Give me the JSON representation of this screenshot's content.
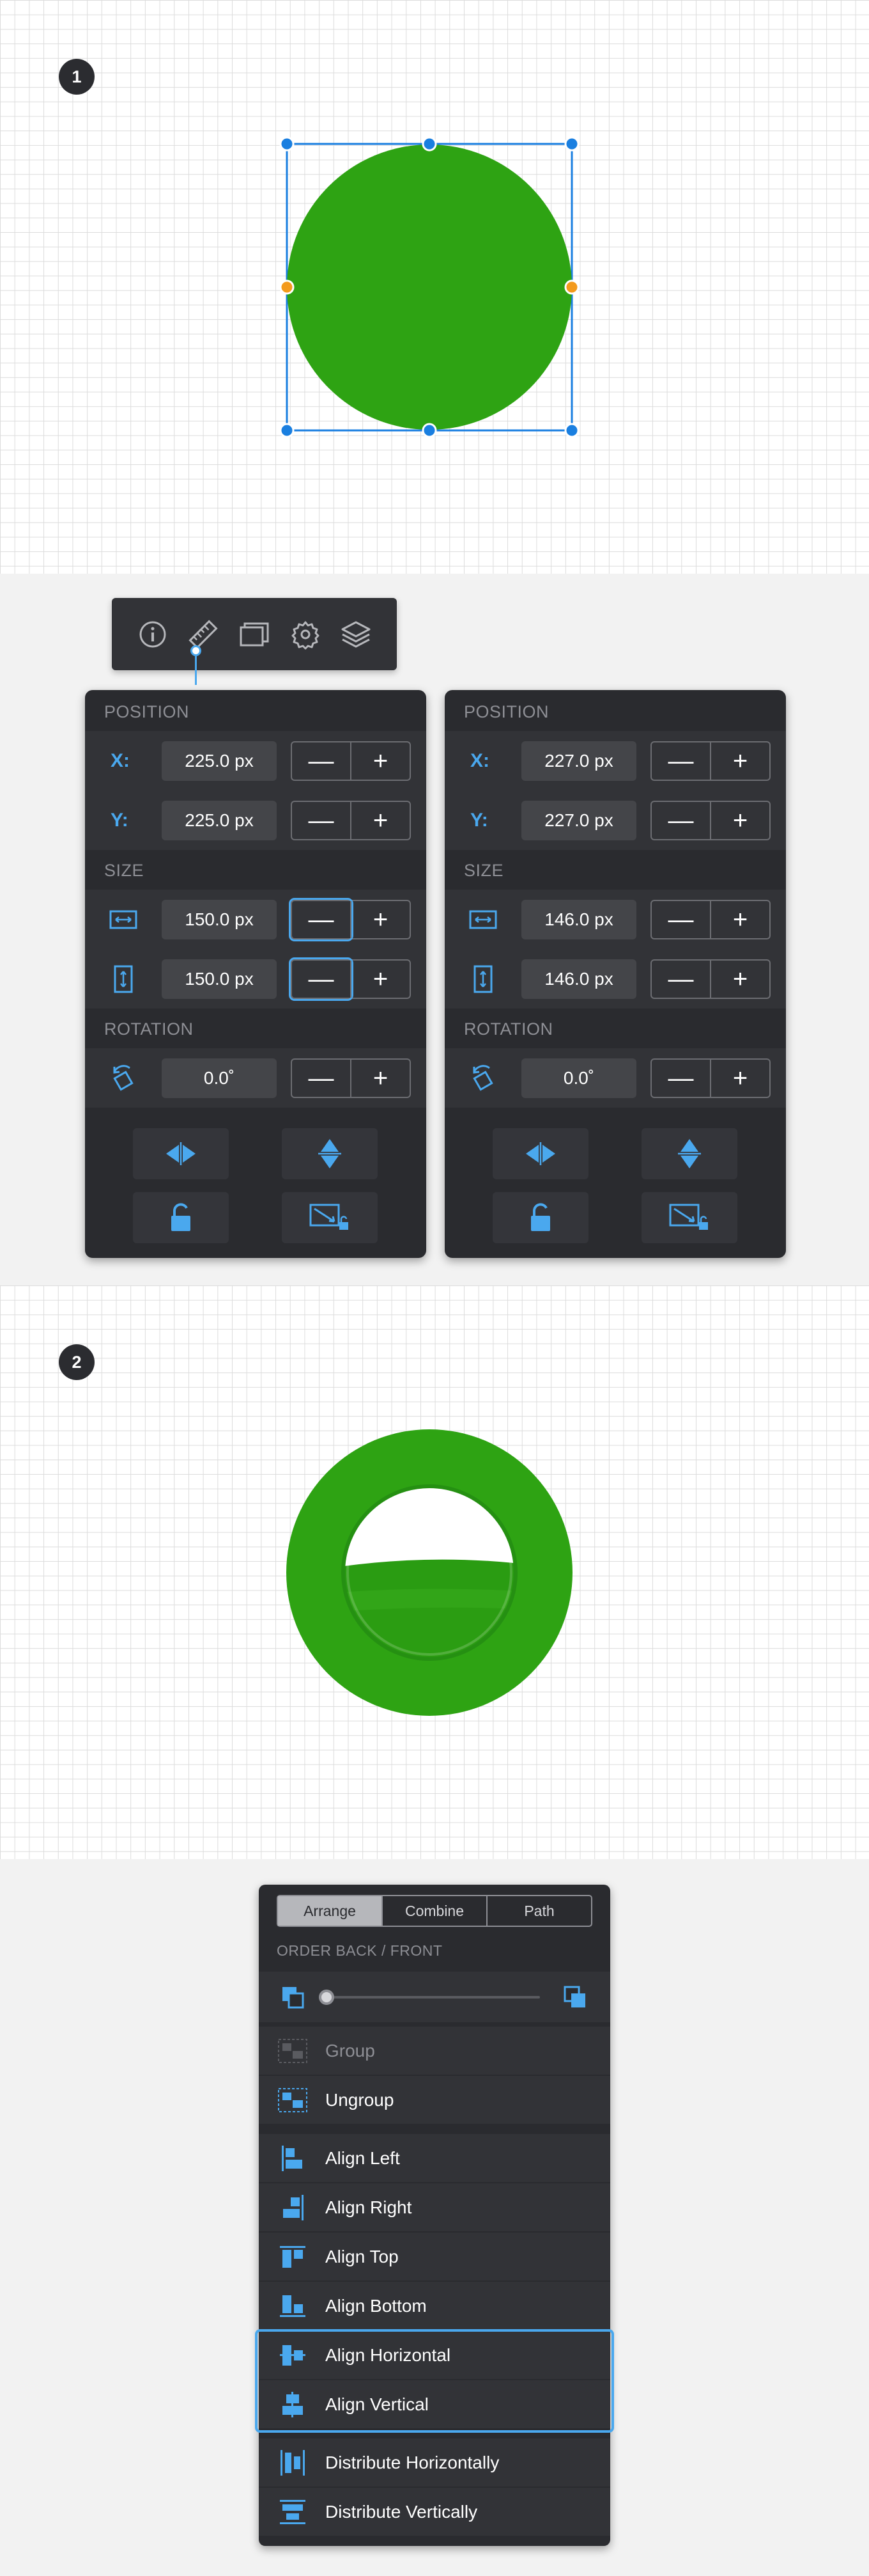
{
  "steps": {
    "step1": "1",
    "step2": "2"
  },
  "toolbar": {
    "icons": [
      "info-icon",
      "ruler-icon",
      "layers-copy-icon",
      "gear-icon",
      "stack-layers-icon"
    ],
    "active": "ruler-icon"
  },
  "inspector_before": {
    "position_header": "POSITION",
    "x_label": "X:",
    "x_value": "225.0 px",
    "y_label": "Y:",
    "y_value": "225.0 px",
    "size_header": "SIZE",
    "width_value": "150.0 px",
    "height_value": "150.0 px",
    "rotation_header": "ROTATION",
    "rotation_value": "0.0˚",
    "minus": "—",
    "plus": "+"
  },
  "inspector_after": {
    "position_header": "POSITION",
    "x_label": "X:",
    "x_value": "227.0 px",
    "y_label": "Y:",
    "y_value": "227.0 px",
    "size_header": "SIZE",
    "width_value": "146.0 px",
    "height_value": "146.0 px",
    "rotation_header": "ROTATION",
    "rotation_value": "0.0˚",
    "minus": "—",
    "plus": "+"
  },
  "arrange": {
    "tabs": [
      "Arrange",
      "Combine",
      "Path"
    ],
    "active_tab": "Arrange",
    "order_header": "ORDER BACK / FRONT",
    "group": "Group",
    "ungroup": "Ungroup",
    "align_left": "Align Left",
    "align_right": "Align Right",
    "align_top": "Align Top",
    "align_bottom": "Align Bottom",
    "align_horizontal": "Align Horizontal",
    "align_vertical": "Align Vertical",
    "distribute_horizontally": "Distribute Horizontally",
    "distribute_vertically": "Distribute Vertically"
  },
  "colors": {
    "accent": "#4aa8ee",
    "shape_green": "#2ea313",
    "handle_blue": "#1a7fe0",
    "handle_orange": "#f39a1c",
    "panel_bg": "#2a2b2f"
  }
}
